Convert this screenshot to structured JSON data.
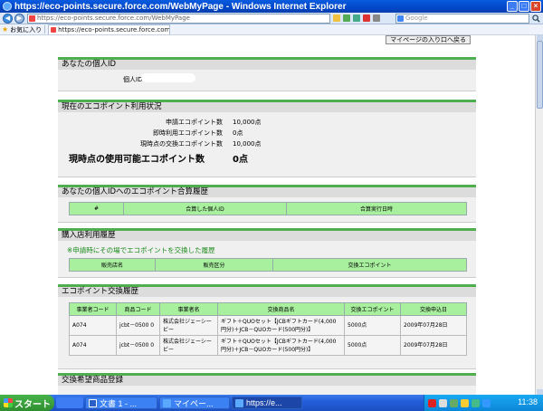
{
  "window": {
    "title": "https://eco-points.secure.force.com/WebMyPage - Windows Internet Explorer",
    "minimize": "_",
    "maximize": "□",
    "close": "×"
  },
  "addressbar": {
    "url": "https://eco-points.secure.force.com/WebMyPage",
    "search_placeholder": "Google"
  },
  "favorites": {
    "label": "お気に入り",
    "tab_title": "https://eco-points.secure.force.com/..."
  },
  "page": {
    "back_button": "マイページの入り口へ戻る",
    "personal_id": {
      "header": "あなたの個人ID",
      "label": "個人ID"
    },
    "points_status": {
      "header": "現在のエコポイント利用状況",
      "rows": [
        {
          "label": "申請エコポイント数",
          "value": "10,000点"
        },
        {
          "label": "即時利用エコポイント数",
          "value": "0点"
        },
        {
          "label": "現時点の交換エコポイント数",
          "value": "10,000点"
        }
      ],
      "available_label": "現時点の使用可能エコポイント数",
      "available_value": "0点"
    },
    "merge_history": {
      "header": "あなたの個人IDへのエコポイント合算履歴",
      "columns": [
        "#",
        "合算した個人ID",
        "合算実行日時"
      ]
    },
    "store_usage": {
      "header": "購入店利用履歴",
      "subtitle": "※申請時にその場でエコポイントを交換した履歴",
      "columns": [
        "販売店名",
        "販売区分",
        "交換エコポイント"
      ]
    },
    "exchange_history": {
      "header": "エコポイント交換履歴",
      "columns": [
        "事業者コード",
        "商品コード",
        "事業者名",
        "交換商品名",
        "交換エコポイント",
        "交換申込日"
      ],
      "rows": [
        {
          "vendor_code": "A074",
          "product_code": "jcbt－0500 0",
          "vendor_name": "株式会社ジェーシービー",
          "product_name": "ギフト＋QUOセット【JCBギフトカード(4,000円分)＋JCB－QUOカード(500円分)】",
          "points": "5000点",
          "date": "2009年07月28日"
        },
        {
          "vendor_code": "A074",
          "product_code": "jcbt－0500 0",
          "vendor_name": "株式会社ジェーシービー",
          "product_name": "ギフト＋QUOセット【JCBギフトカード(4,000円分)＋JCB－QUOカード(500円分)】",
          "points": "5000点",
          "date": "2009年07月28日"
        }
      ]
    },
    "wishlist": {
      "header": "交換希望商品登録"
    }
  },
  "taskbar": {
    "start": "スタート",
    "buttons": [
      "文書 1 - ...",
      "マイペー...",
      "https://e..."
    ],
    "time": "11:38"
  },
  "colors": {
    "section_accent": "#4fae4f",
    "table_header": "#a8ef9e",
    "subtitle_green": "#1a8a1a",
    "titlebar_blue": "#0247c9"
  }
}
